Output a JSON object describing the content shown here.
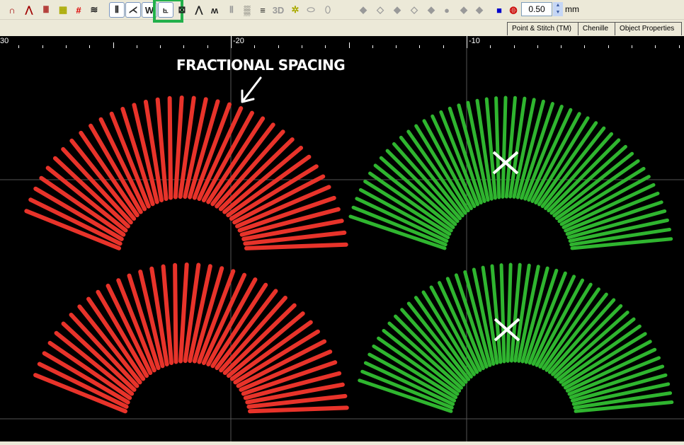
{
  "toolbar": {
    "spacing_value": "0.50",
    "unit": "mm",
    "label_3d": "3D"
  },
  "tabs": [
    "Point & Stitch (TM)",
    "Chenille",
    "Object Properties"
  ],
  "ruler": {
    "labels": [
      "30",
      "-20",
      "-10"
    ]
  },
  "annotation": "FRACTIONAL SPACING",
  "colors": {
    "red": "#e8332a",
    "green": "#2fb52f",
    "highlight": "#22b04a"
  },
  "fans": [
    {
      "name": "top-left-red",
      "color": "red",
      "spacing": "fractional"
    },
    {
      "name": "top-right-green",
      "color": "green",
      "marked": "x"
    },
    {
      "name": "bottom-left-red",
      "color": "red"
    },
    {
      "name": "bottom-right-green",
      "color": "green",
      "marked": "x"
    }
  ]
}
